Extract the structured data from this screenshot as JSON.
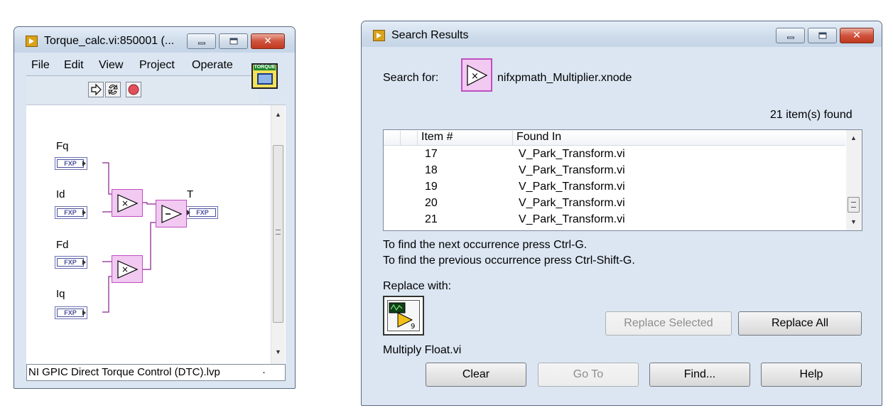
{
  "vi_window": {
    "title": "Torque_calc.vi:850001 (...",
    "menu": [
      "File",
      "Edit",
      "View",
      "Project",
      "Operate"
    ],
    "icon_label": "TORQUE",
    "status_bar": "NI GPIC Direct Torque Control (DTC).lvp",
    "status_suffix": "·",
    "diagram": {
      "inputs": [
        {
          "label": "Fq",
          "type": "FXP"
        },
        {
          "label": "Id",
          "type": "FXP"
        },
        {
          "label": "Fd",
          "type": "FXP"
        },
        {
          "label": "Iq",
          "type": "FXP"
        }
      ],
      "output": {
        "label": "T",
        "type": "FXP"
      },
      "primitives": [
        "multiply",
        "multiply",
        "subtract"
      ]
    }
  },
  "search_window": {
    "title": "Search Results",
    "search_for_label": "Search for:",
    "search_item": "nifxpmath_Multiplier.xnode",
    "found_count": "21 item(s) found",
    "columns": [
      "Item #",
      "Found In"
    ],
    "rows": [
      {
        "item": "17",
        "found_in": "V_Park_Transform.vi"
      },
      {
        "item": "18",
        "found_in": "V_Park_Transform.vi"
      },
      {
        "item": "19",
        "found_in": "V_Park_Transform.vi"
      },
      {
        "item": "20",
        "found_in": "V_Park_Transform.vi"
      },
      {
        "item": "21",
        "found_in": "V_Park_Transform.vi"
      }
    ],
    "hint_next": "To find the next occurrence press Ctrl-G.",
    "hint_prev": "To find the previous occurrence press Ctrl-Shift-G.",
    "replace_with_label": "Replace with:",
    "replace_item": "Multiply Float.vi",
    "buttons": {
      "replace_selected": "Replace Selected",
      "replace_all": "Replace All",
      "clear": "Clear",
      "go_to": "Go To",
      "find": "Find...",
      "help": "Help"
    }
  }
}
